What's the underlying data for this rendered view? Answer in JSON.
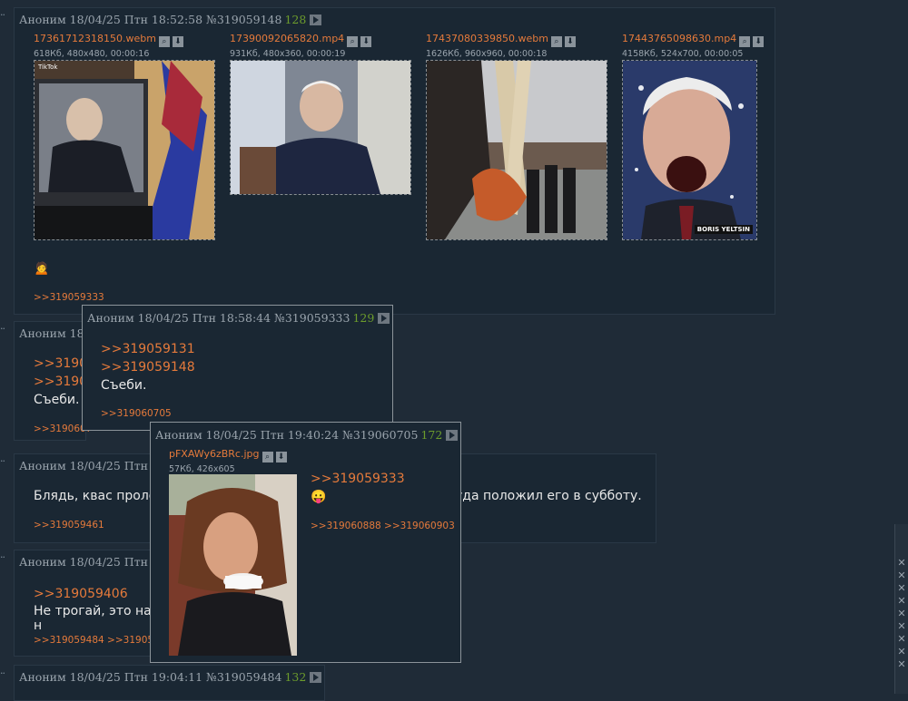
{
  "main_post": {
    "header": "Аноним 18/04/25 Птн 18:52:58 №319059148",
    "number": "128",
    "files": [
      {
        "name": "17361712318150.webm",
        "meta": "618Кб, 480x480, 00:00:16",
        "overlay": "TikTok"
      },
      {
        "name": "17390092065820.mp4",
        "meta": "931Кб, 480x360, 00:00:19"
      },
      {
        "name": "17437080339850.webm",
        "meta": "1626Кб, 960x960, 00:00:18"
      },
      {
        "name": "17443765098630.mp4",
        "meta": "4158Кб, 524x700, 00:00:05",
        "overlay": "BORIS YELTSIN"
      }
    ],
    "emoji": "🙍",
    "reply": ">>319059333"
  },
  "post2": {
    "header": "Аноним 18/",
    "quote1": ">>31905",
    "quote2": ">>31905",
    "text": "Съеби.",
    "reply": ">>3190607"
  },
  "post3": {
    "header": "Аноним 18/04/25 Птн 1",
    "text_left": "Блядь, квас пролез",
    "text_right": "уда положил его в субботу.",
    "reply": ">>319059461"
  },
  "post4": {
    "header": "Аноним 18/04/25 Птн 1",
    "quote": ">>319059406",
    "text": "Не трогай, это на н",
    "replies": ">>319059484 >>3190595"
  },
  "post5": {
    "header": "Аноним 18/04/25 Птн 19:04:11 №319059484",
    "number": "132"
  },
  "popup1": {
    "header": "Аноним 18/04/25 Птн 18:58:44 №319059333",
    "number": "129",
    "quote1": ">>319059131",
    "quote2": ">>319059148",
    "text": "Съеби.",
    "reply": ">>319060705"
  },
  "popup2": {
    "header": "Аноним 18/04/25 Птн 19:40:24 №319060705",
    "number": "172",
    "file": {
      "name": "pFXAWy6zBRc.jpg",
      "meta": "57Кб, 426x605"
    },
    "quote": ">>319059333",
    "emoji": "😛",
    "replies": ">>319060888 >>319060903"
  },
  "icons": {
    "search": "🔍",
    "download": "⬇",
    "arrow": "✕"
  },
  "colors": {
    "link": "#e57a3b",
    "post_number": "#6c9b2c",
    "background": "#1f2b37"
  }
}
